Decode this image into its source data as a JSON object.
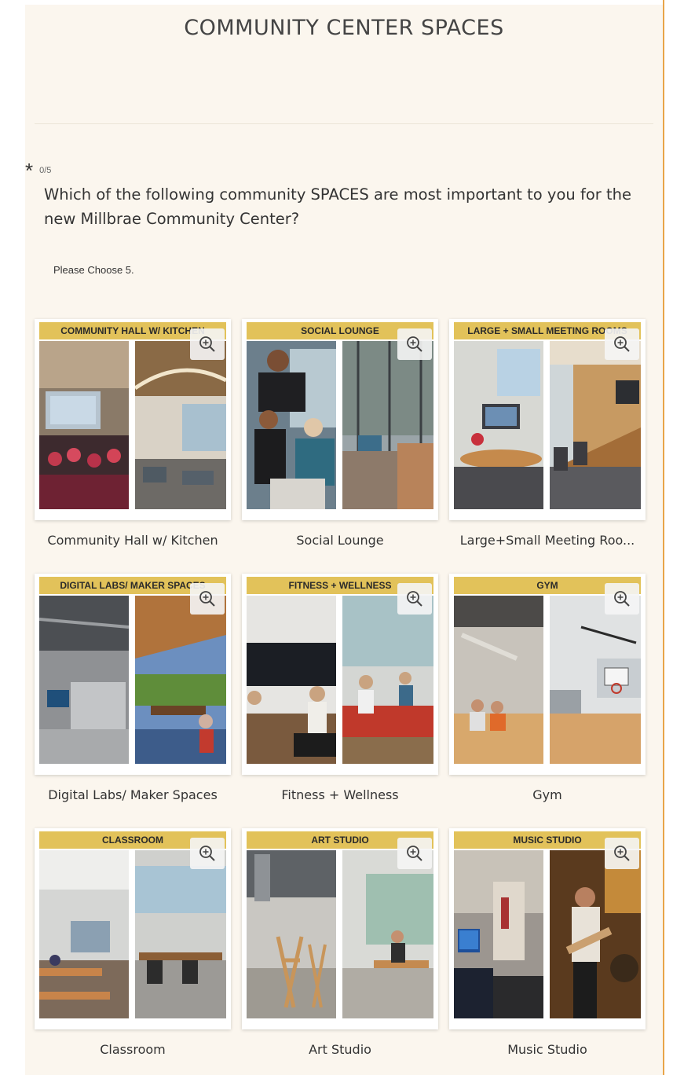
{
  "survey": {
    "section_title": "COMMUNITY CENTER SPACES",
    "required_marker": "*",
    "selection_count": "0/5",
    "question": "Which of the following community SPACES are most important to you for the new Millbrae Community Center?",
    "instruction": "Please Choose 5."
  },
  "options": [
    {
      "banner": "COMMUNITY HALL W/ KITCHEN",
      "label": "Community Hall w/ Kitchen"
    },
    {
      "banner": "SOCIAL LOUNGE",
      "label": "Social Lounge"
    },
    {
      "banner": "LARGE + SMALL MEETING ROOMS",
      "label": "Large+Small Meeting Roo..."
    },
    {
      "banner": "DIGITAL LABS/ MAKER SPACES",
      "label": "Digital Labs/ Maker Spaces"
    },
    {
      "banner": "FITNESS + WELLNESS",
      "label": "Fitness + Wellness"
    },
    {
      "banner": "GYM",
      "label": "Gym"
    },
    {
      "banner": "CLASSROOM",
      "label": "Classroom"
    },
    {
      "banner": "ART STUDIO",
      "label": "Art Studio"
    },
    {
      "banner": "MUSIC STUDIO",
      "label": "Music Studio"
    }
  ],
  "colors": {
    "accent": "#e8a54a",
    "banner": "#e2c25a",
    "background": "#fbf6ee"
  },
  "icons": {
    "zoom": "zoom-in-icon",
    "required": "asterisk"
  }
}
